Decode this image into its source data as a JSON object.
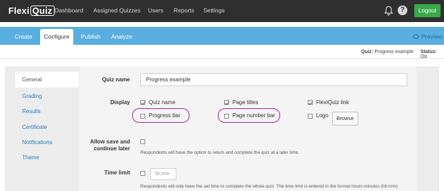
{
  "app": {
    "logo_text_1": "Flexi",
    "logo_text_2": "Quiz"
  },
  "nav": {
    "items": [
      "Dashboard",
      "Assigned Quizzes",
      "Users",
      "Reports",
      "Settings"
    ],
    "logout_label": "Logout"
  },
  "tabs": {
    "items": [
      "Create",
      "Configure",
      "Publish",
      "Analyze"
    ],
    "active": "Configure",
    "preview_label": "Preview"
  },
  "status": {
    "quiz_label": "Quiz:",
    "quiz_value": "Progress example",
    "status_label": "Status:",
    "status_value": "Op"
  },
  "sidebar": {
    "items": [
      "General",
      "Grading",
      "Results",
      "Certificate",
      "Notifications",
      "Theme"
    ],
    "active": "General"
  },
  "form": {
    "quiz_name_label": "Quiz name",
    "quiz_name_value": "Progress example",
    "display_label": "Display",
    "display_options": [
      {
        "label": "Quiz name",
        "checked": true
      },
      {
        "label": "Page titles",
        "checked": true
      },
      {
        "label": "FlexiQuiz link",
        "checked": true
      },
      {
        "label": "Progress bar",
        "checked": false
      },
      {
        "label": "Page number bar",
        "checked": false
      },
      {
        "label": "Logo",
        "checked": false
      }
    ],
    "browse_label": "Browse",
    "allow_save_label_1": "Allow save and",
    "allow_save_label_2": "continue later",
    "allow_save_checked": false,
    "allow_save_help": "Respondents will have the option to return and complete the quiz at a later time.",
    "time_limit_label": "Time limit",
    "time_limit_checked": false,
    "time_limit_placeholder": "hh:mm",
    "time_limit_help": "Respondents will only have the set time to complete the whole quiz. The time limit is entered in the format hours:minutes (hh:mm)"
  },
  "colors": {
    "navbar": "#2f2f2f",
    "tabbar": "#5aaedf",
    "logout": "#3aa84a",
    "highlight": "#9c2a9c",
    "link": "#2a7ab8"
  }
}
